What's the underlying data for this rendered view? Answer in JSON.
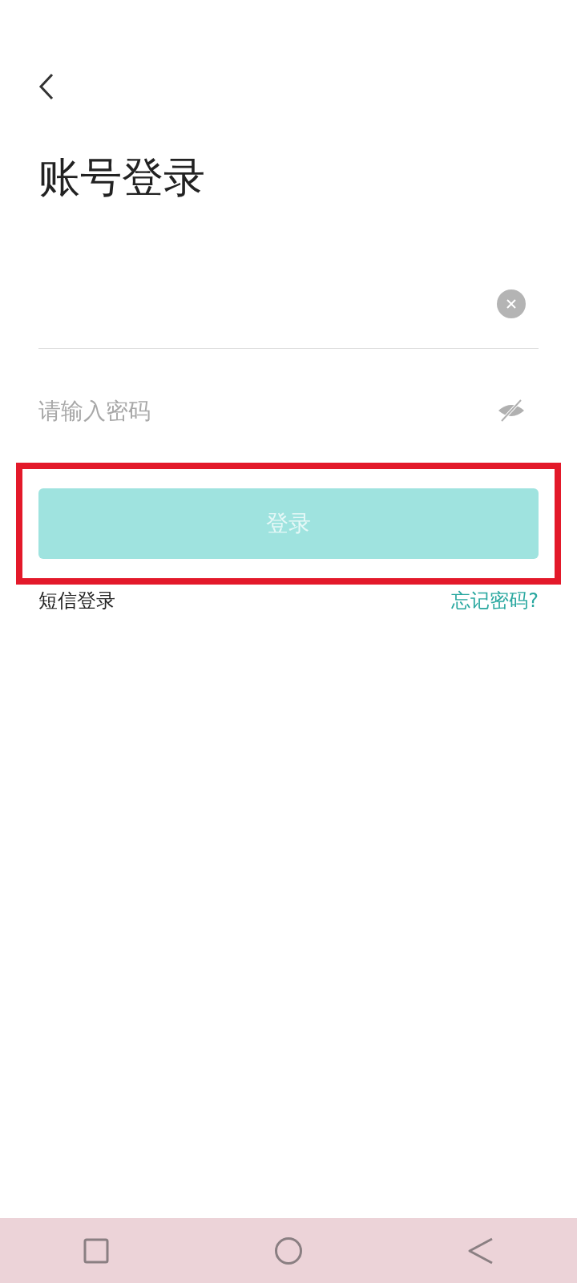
{
  "title": "账号登录",
  "account_field": {
    "clearable": true
  },
  "password_field": {
    "placeholder": "请输入密码",
    "visible": false
  },
  "login_button": {
    "label": "登录",
    "disabled": true,
    "highlighted": true
  },
  "links": [
    {
      "label": "短信登录",
      "kind": "plain"
    },
    {
      "label": "忘记密码?",
      "kind": "accent"
    }
  ],
  "nav_bar": {
    "buttons": [
      {
        "kind": "recents"
      },
      {
        "kind": "home"
      },
      {
        "kind": "back"
      }
    ]
  }
}
